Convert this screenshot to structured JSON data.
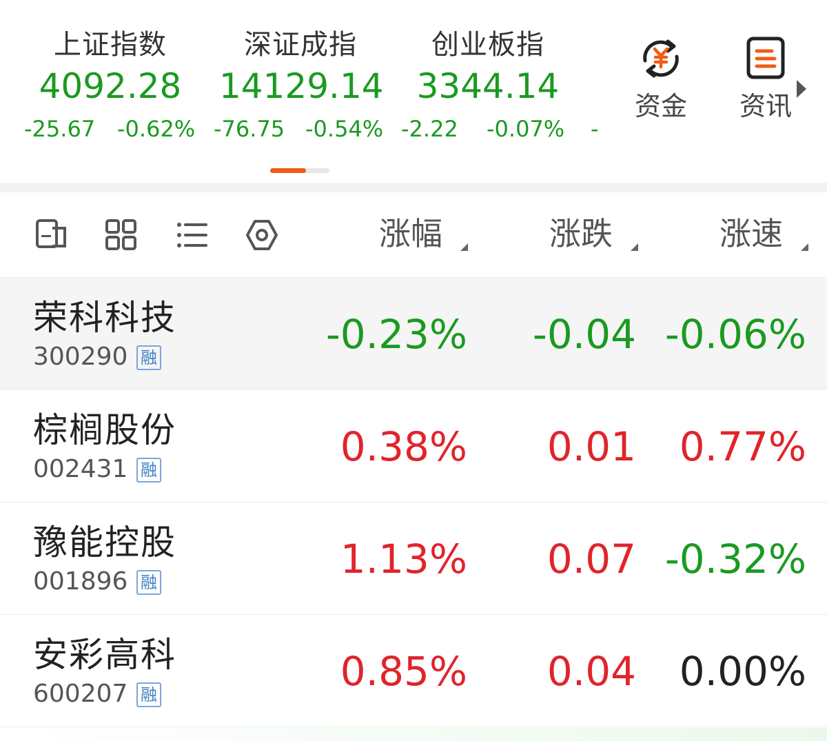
{
  "indices": [
    {
      "name": "上证指数",
      "value": "4092.28",
      "change": "-25.67",
      "change_pct": "-0.62%"
    },
    {
      "name": "深证成指",
      "value": "14129.14",
      "change": "-76.75",
      "change_pct": "-0.54%"
    },
    {
      "name": "创业板指",
      "value": "3344.14",
      "change": "-2.22",
      "change_pct": "-0.07%"
    }
  ],
  "more_dash": "-",
  "quick_links": [
    {
      "label": "资金",
      "icon": "yuan-flow-icon"
    },
    {
      "label": "资讯",
      "icon": "news-doc-icon"
    }
  ],
  "colors": {
    "up": "#e0242b",
    "down": "#1a9a20",
    "flat": "#222222",
    "accent": "#f25b14"
  },
  "table": {
    "toolbar_icons": [
      "watchlist-edit-icon",
      "grid-view-icon",
      "list-view-icon",
      "settings-hex-icon"
    ],
    "columns": [
      "涨幅",
      "涨跌",
      "涨速"
    ],
    "rows": [
      {
        "name": "荣科科技",
        "code": "300290",
        "tag": "融",
        "pct": "-0.23%",
        "chg": "-0.04",
        "speed": "-0.06%"
      },
      {
        "name": "棕榈股份",
        "code": "002431",
        "tag": "融",
        "pct": "0.38%",
        "chg": "0.01",
        "speed": "0.77%"
      },
      {
        "name": "豫能控股",
        "code": "001896",
        "tag": "融",
        "pct": "1.13%",
        "chg": "0.07",
        "speed": "-0.32%"
      },
      {
        "name": "安彩高科",
        "code": "600207",
        "tag": "融",
        "pct": "0.85%",
        "chg": "0.04",
        "speed": "0.00%"
      }
    ]
  }
}
